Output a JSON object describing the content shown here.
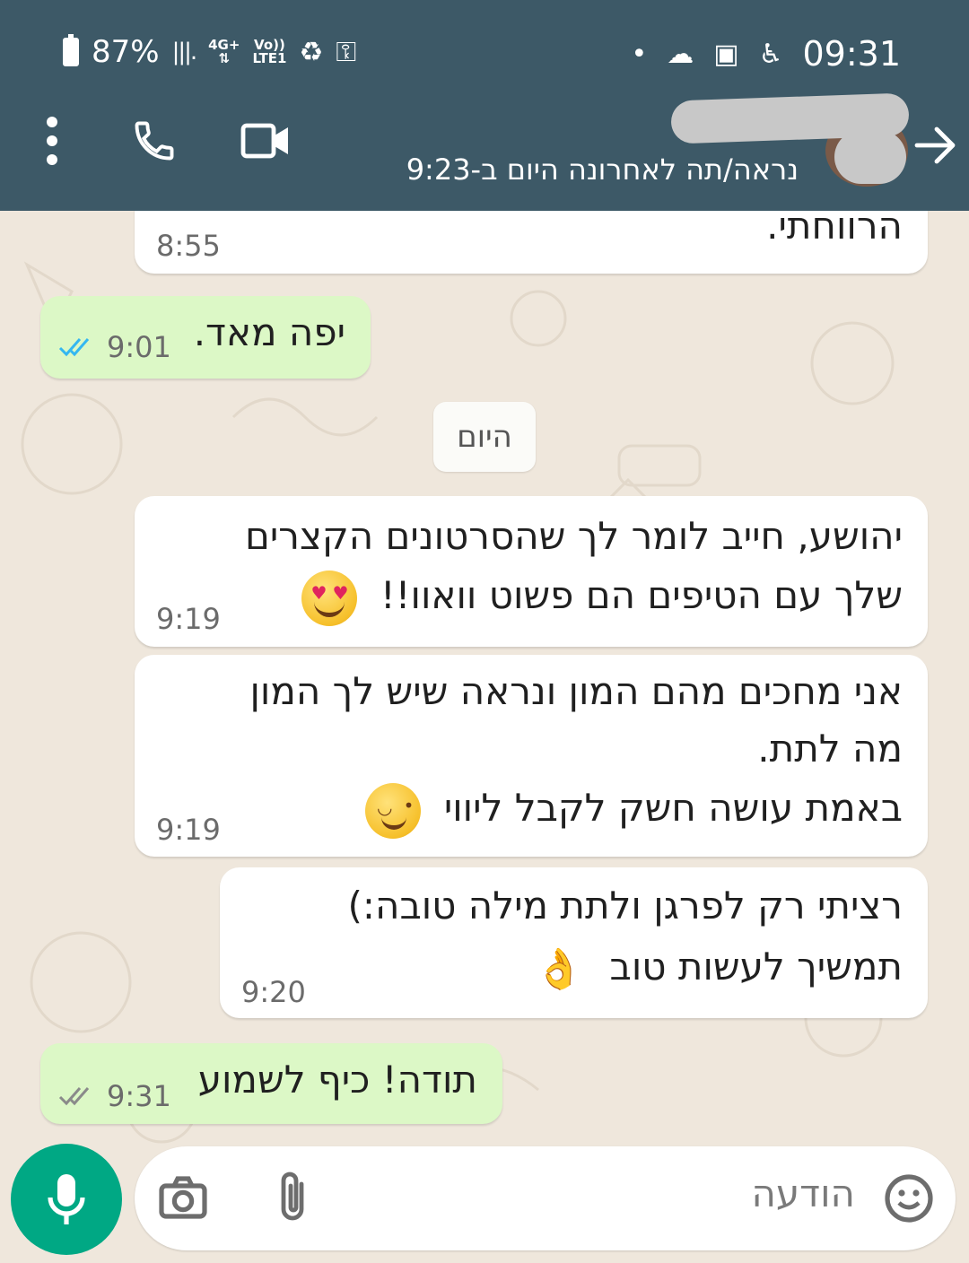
{
  "status_bar": {
    "battery": "87%",
    "network_type": "4G+",
    "volte": "Vo))",
    "lte": "LTE1",
    "clock": "09:31"
  },
  "header": {
    "last_seen": "נראה/תה לאחרונה היום ב-9:23"
  },
  "messages": [
    {
      "dir": "in",
      "lines": [
        "הרווחתי."
      ],
      "time": "8:55"
    },
    {
      "dir": "out",
      "lines": [
        "יפה מאד."
      ],
      "time": "9:01",
      "read": true
    },
    {
      "dir": "in",
      "lines": [
        "יהושע, חייב לומר לך שהסרטונים הקצרים",
        "שלך עם הטיפים הם פשוט וואוו!!"
      ],
      "time": "9:19",
      "emoji": "heart-eyes-emoji"
    },
    {
      "dir": "in",
      "lines": [
        "אני מחכים מהם המון ונראה שיש לך המון",
        "מה לתת.",
        "באמת עושה חשק לקבל ליווי"
      ],
      "time": "9:19",
      "emoji": "wink-emoji"
    },
    {
      "dir": "in",
      "lines": [
        "רציתי רק לפרגן ולתת מילה טובה:)",
        "תמשיך לעשות טוב"
      ],
      "time": "9:20",
      "emoji": "ok-hand-emoji"
    },
    {
      "dir": "out",
      "lines": [
        "תודה! כיף לשמוע"
      ],
      "time": "9:31",
      "read": false
    }
  ],
  "day_separator": "היום",
  "composer": {
    "placeholder": "הודעה"
  },
  "colors": {
    "header": "#3d5967",
    "outgoing_bubble": "#dcf8c6",
    "incoming_bubble": "#ffffff",
    "read_ticks": "#34b7f1",
    "mic": "#00a884"
  }
}
